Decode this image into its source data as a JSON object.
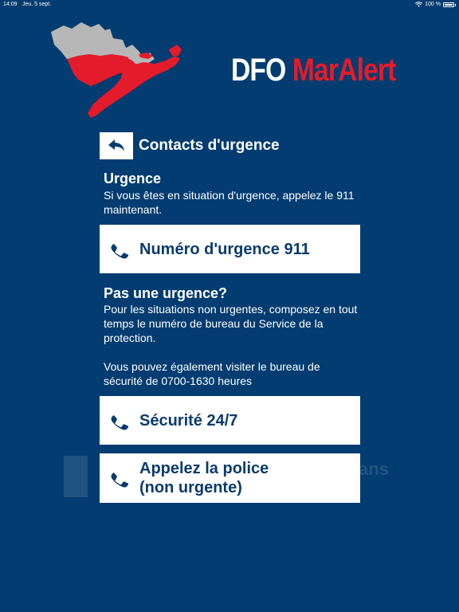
{
  "status_bar": {
    "time": "14:09",
    "date": "Jeu. 5 sept.",
    "battery": "100 %"
  },
  "brand": {
    "part1": "DFO",
    "part2": "MarAlert"
  },
  "colors": {
    "background": "#033c70",
    "accent_red": "#e31b2a",
    "button_bg": "#ffffff",
    "button_text": "#0b3b6d"
  },
  "watermark": {
    "text": "ans"
  },
  "page": {
    "title": "Contacts d'urgence"
  },
  "emergency": {
    "heading": "Urgence",
    "text": "Si vous êtes en situation d'urgence, appelez le 911 maintenant.",
    "button_label": "Numéro d'urgence 911"
  },
  "non_emergency": {
    "heading": "Pas une urgence?",
    "text1": "Pour les situations non urgentes, composez en tout temps le numéro de bureau du Service de la protection.",
    "text2": "Vous pouvez également visiter le bureau de sécurité de 0700-1630 heures",
    "security_button_label": "Sécurité 24/7",
    "police_button_line1": "Appelez la police",
    "police_button_line2": "(non urgente)"
  },
  "icons": {
    "back": "back-arrow-icon",
    "phone": "phone-icon",
    "wifi": "wifi-icon",
    "battery": "battery-icon"
  }
}
